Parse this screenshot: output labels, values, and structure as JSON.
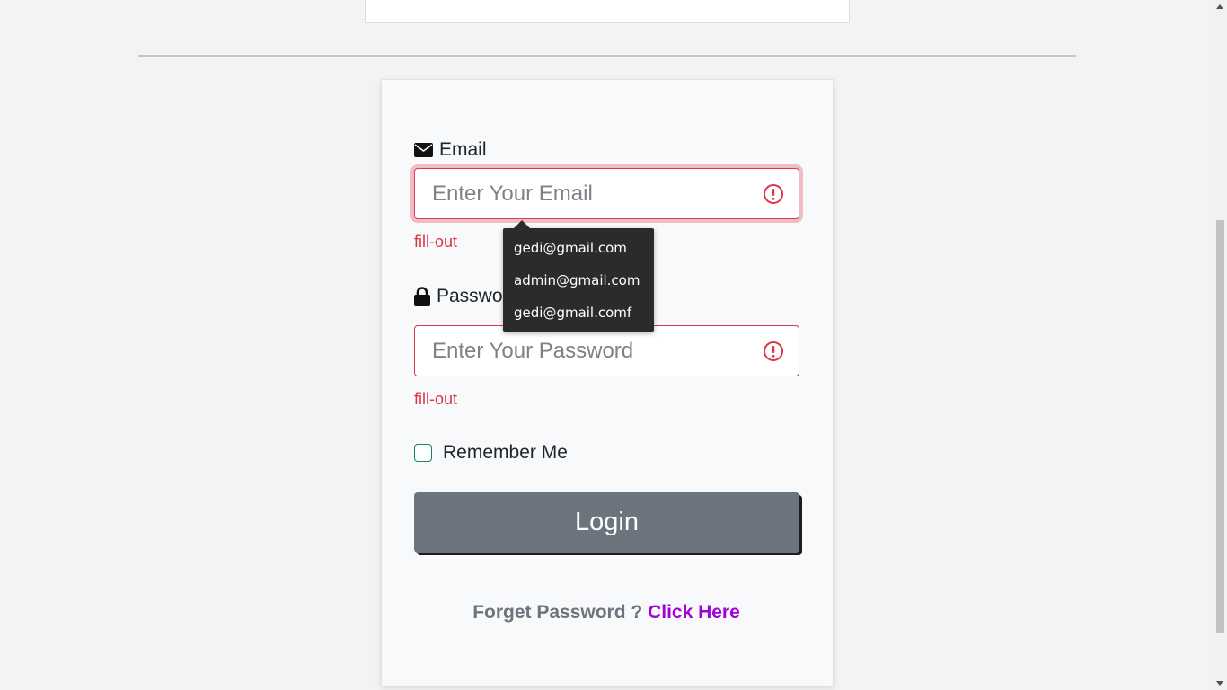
{
  "email": {
    "label": "Email",
    "placeholder": "Enter Your Email",
    "error": "fill-out"
  },
  "password": {
    "label": "Password",
    "placeholder": "Enter Your Password",
    "error": "fill-out"
  },
  "autocomplete": {
    "items": [
      "gedi@gmail.com",
      "admin@gmail.com",
      "gedi@gmail.comf"
    ]
  },
  "remember": {
    "label": "Remember Me",
    "checked": false
  },
  "login": {
    "label": "Login"
  },
  "forget": {
    "text": "Forget Password ?",
    "link": "Click Here"
  },
  "colors": {
    "error": "#dc3545",
    "button": "#6c757d",
    "link": "#a100d6",
    "checkbox_border": "#198754",
    "dropdown_bg": "#2b2b2b"
  },
  "icons": {
    "email": "envelope-icon",
    "password": "lock-icon",
    "warning": "exclamation-circle-icon"
  }
}
